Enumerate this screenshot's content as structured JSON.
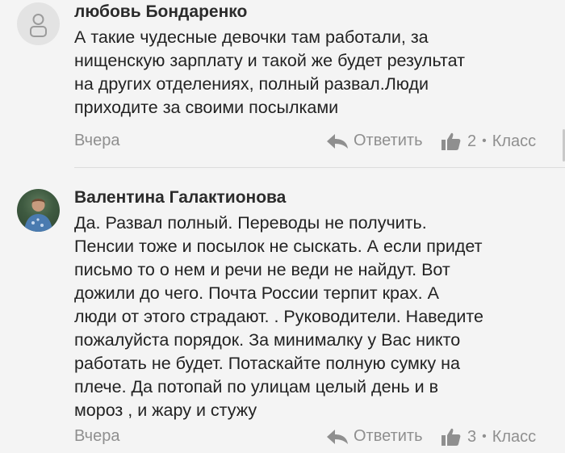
{
  "comments": [
    {
      "author": "любовь Бондаренко",
      "avatar_icon": "user-placeholder-icon",
      "text": "А такие чудесные девочки там работали, за\nнищенскую зарплату и такой же будет результат\nна других отделениях, полный развал.Люди\nприходите за своими посылками",
      "date": "Вчера",
      "reply_label": "Ответить",
      "like_count": "2",
      "class_label": "Класс"
    },
    {
      "author": "Валентина Галактионова",
      "avatar_icon": "user-photo-avatar",
      "text": "Да. Развал полный. Переводы не получить.\nПенсии тоже и посылок не сыскать. А если придет\nписьмо то о нем и речи не веди не найдут. Вот\nдожили до чего. Почта России терпит крах. А\nлюди от этого страдают. . Руководители. Наведите\nпожалуйста  порядок. За минималку у Вас никто\nработать не будет. Потаскайте полную сумку на\nплече. Да потопай по улицам целый день и в\nмороз , и жару и стужу",
      "date": "Вчера",
      "reply_label": "Ответить",
      "like_count": "3",
      "class_label": "Класс"
    }
  ],
  "separator": "•",
  "colors": {
    "background": "#f4f4f4",
    "text": "#222222",
    "meta": "#8f8f8f",
    "divider": "#dcdcdc"
  }
}
